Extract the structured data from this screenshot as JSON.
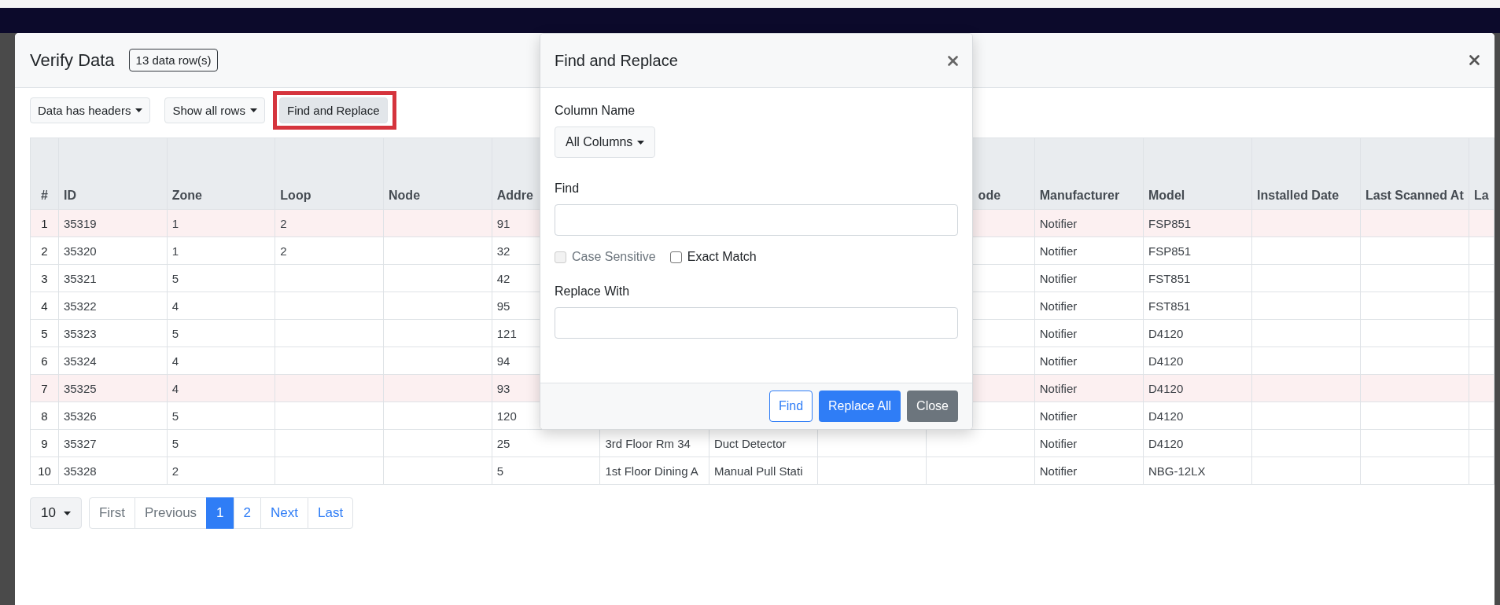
{
  "modal": {
    "title": "Verify Data",
    "badge": "13 data row(s)"
  },
  "toolbar": [
    {
      "label": "Data has headers",
      "kind": "dropdown",
      "annotated": false
    },
    {
      "label": "Show all rows",
      "kind": "dropdown",
      "annotated": false
    },
    {
      "label": "Find and Replace",
      "kind": "button",
      "annotated": true
    }
  ],
  "table": {
    "columns": [
      {
        "label": "#"
      },
      {
        "label": "ID"
      },
      {
        "label": "Zone"
      },
      {
        "label": "Loop"
      },
      {
        "label": "Node"
      },
      {
        "label": "Addre"
      },
      {},
      {},
      {},
      {
        "label": "ode"
      },
      {
        "label": "Manufacturer"
      },
      {
        "label": "Model"
      },
      {
        "label": "Installed Date"
      },
      {
        "label": "Last Scanned At"
      },
      {
        "label": "La"
      }
    ],
    "rows": [
      {
        "cells": [
          "1",
          "35319",
          "1",
          "2",
          null,
          "91",
          null,
          null,
          null,
          null,
          "Notifier",
          "FSP851",
          null,
          null,
          null
        ],
        "highlighted": true
      },
      {
        "cells": [
          "2",
          "35320",
          "1",
          "2",
          null,
          "32",
          null,
          null,
          null,
          null,
          "Notifier",
          "FSP851",
          null,
          null,
          null
        ],
        "highlighted": false
      },
      {
        "cells": [
          "3",
          "35321",
          "5",
          null,
          null,
          "42",
          null,
          null,
          null,
          null,
          "Notifier",
          "FST851",
          null,
          null,
          null
        ],
        "highlighted": false
      },
      {
        "cells": [
          "4",
          "35322",
          "4",
          null,
          null,
          "95",
          null,
          null,
          null,
          null,
          "Notifier",
          "FST851",
          null,
          null,
          null
        ],
        "highlighted": false
      },
      {
        "cells": [
          "5",
          "35323",
          "5",
          null,
          null,
          "121",
          null,
          null,
          null,
          null,
          "Notifier",
          "D4120",
          null,
          null,
          null
        ],
        "highlighted": false
      },
      {
        "cells": [
          "6",
          "35324",
          "4",
          null,
          null,
          "94",
          null,
          null,
          null,
          null,
          "Notifier",
          "D4120",
          null,
          null,
          null
        ],
        "highlighted": false
      },
      {
        "cells": [
          "7",
          "35325",
          "4",
          null,
          null,
          "93",
          null,
          null,
          null,
          null,
          "Notifier",
          "D4120",
          null,
          null,
          null
        ],
        "highlighted": true
      },
      {
        "cells": [
          "8",
          "35326",
          "5",
          null,
          null,
          "120",
          null,
          null,
          null,
          null,
          "Notifier",
          "D4120",
          null,
          null,
          null
        ],
        "highlighted": false
      },
      {
        "cells": [
          "9",
          "35327",
          "5",
          null,
          null,
          "25",
          "3rd Floor Rm 34",
          "Duct Detector",
          null,
          null,
          "Notifier",
          "D4120",
          null,
          null,
          null
        ],
        "highlighted": false
      },
      {
        "cells": [
          "10",
          "35328",
          "2",
          null,
          null,
          "5",
          "1st Floor Dining A",
          "Manual Pull Stati",
          null,
          null,
          "Notifier",
          "NBG-12LX",
          null,
          null,
          null
        ],
        "highlighted": false
      }
    ]
  },
  "page_size": "10",
  "pagination": [
    {
      "label": "First",
      "selected": false,
      "disabled": true
    },
    {
      "label": "Previous",
      "selected": false,
      "disabled": true
    },
    {
      "label": "1",
      "selected": true,
      "disabled": false
    },
    {
      "label": "2",
      "selected": false,
      "disabled": false
    },
    {
      "label": "Next",
      "selected": false,
      "disabled": false
    },
    {
      "label": "Last",
      "selected": false,
      "disabled": false
    }
  ],
  "dialog": {
    "title": "Find and Replace",
    "column_label": "Column Name",
    "column_select": "All Columns",
    "find_label": "Find",
    "options": [
      {
        "label": "Case Sensitive",
        "checked": false,
        "disabled": true
      },
      {
        "label": "Exact Match",
        "checked": false,
        "disabled": false
      }
    ],
    "replace_label": "Replace With",
    "buttons": [
      {
        "label": "Find",
        "kind": "outline"
      },
      {
        "label": "Replace All",
        "kind": "primary"
      },
      {
        "label": "Close",
        "kind": "secondary"
      }
    ]
  }
}
